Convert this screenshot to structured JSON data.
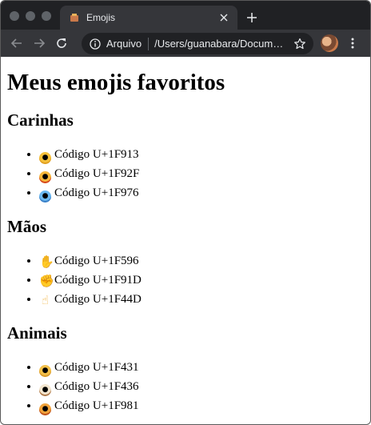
{
  "browser": {
    "tab": {
      "favicon": "emoji-favicon",
      "title": "Emojis"
    },
    "address": {
      "security_label": "Arquivo",
      "url": "/Users/guanabara/Documentos/emojis.html"
    }
  },
  "page": {
    "title": "Meus emojis favoritos",
    "sections": [
      {
        "heading": "Carinhas",
        "items": [
          {
            "icon": "nerd-face-emoji",
            "text": "Código U+1F913"
          },
          {
            "icon": "disguised-face-emoji",
            "text": "Código U+1F92F"
          },
          {
            "icon": "cold-face-emoji",
            "text": "Código U+1F976"
          }
        ]
      },
      {
        "heading": "Mãos",
        "items": [
          {
            "icon": "raised-hand-emoji",
            "text": "Código U+1F596"
          },
          {
            "icon": "handshake-emoji",
            "text": "Código U+1F91D"
          },
          {
            "icon": "thumbs-up-emoji",
            "text": "Código U+1F44D"
          }
        ]
      },
      {
        "heading": "Animais",
        "items": [
          {
            "icon": "cat-face-emoji",
            "text": "Código U+1F431"
          },
          {
            "icon": "dog-face-emoji",
            "text": "Código U+1F436"
          },
          {
            "icon": "lion-face-emoji",
            "text": "Código U+1F981"
          }
        ]
      }
    ]
  }
}
